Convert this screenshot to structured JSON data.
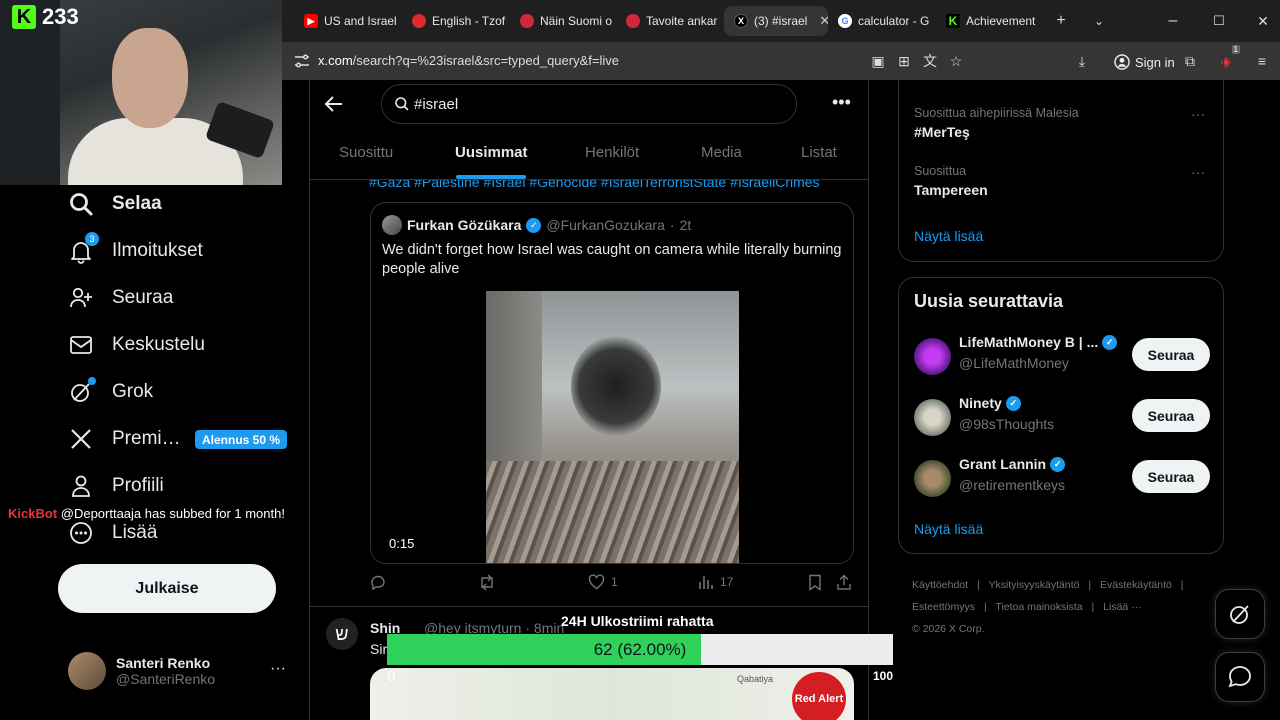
{
  "stream": {
    "viewer_count": "233",
    "kickbot_name": "KickBot",
    "kickbot_message": "@Deporttaaja has subbed for 1 month!",
    "goal": {
      "title": "24H Ulkostriimi rahatta",
      "label": "62 (62.00%)",
      "value": 62,
      "max": 100,
      "percent": 62,
      "min_label": "0",
      "max_label": "100"
    }
  },
  "browser": {
    "tabs": [
      {
        "label": "US and Israel",
        "icon": "youtube-icon",
        "color": "#ff0000",
        "active": false
      },
      {
        "label": "English - Tzof",
        "icon": "red-fav-icon",
        "color": "#e0282e",
        "active": false
      },
      {
        "label": "Näin Suomi o",
        "icon": "yle-icon",
        "color": "#d2283c",
        "active": false
      },
      {
        "label": "Tavoite ankar",
        "icon": "yle-icon",
        "color": "#d2283c",
        "active": false
      },
      {
        "label": "(3) #israel",
        "icon": "x-icon",
        "color": "#000000",
        "active": true
      },
      {
        "label": "calculator - G",
        "icon": "google-icon",
        "color": "#4285f4",
        "active": false
      },
      {
        "label": "Achievement",
        "icon": "kick-icon",
        "color": "#53fc18",
        "active": false
      }
    ],
    "url_host": "x.com",
    "url_path": "/search?q=%23israel&src=typed_query&f=live",
    "sign_in_label": "Sign in",
    "extension_badge": "1"
  },
  "nav": {
    "items": [
      {
        "key": "explore",
        "label": "Selaa",
        "icon": "search-icon",
        "bold": true
      },
      {
        "key": "notifications",
        "label": "Ilmoitukset",
        "icon": "bell-icon",
        "badge": "3"
      },
      {
        "key": "follow",
        "label": "Seuraa",
        "icon": "person-add-icon"
      },
      {
        "key": "messages",
        "label": "Keskustelu",
        "icon": "mail-icon"
      },
      {
        "key": "grok",
        "label": "Grok",
        "icon": "grok-icon"
      },
      {
        "key": "premium",
        "label": "Premi…",
        "icon": "x-logo-icon"
      },
      {
        "key": "profile",
        "label": "Profiili",
        "icon": "person-icon"
      },
      {
        "key": "more",
        "label": "Lisää",
        "icon": "more-circle-icon"
      }
    ],
    "premium_badge": "Alennus 50 %",
    "post_button": "Julkaise",
    "profile_name": "Santeri Renko",
    "profile_handle": "@SanteriRenko"
  },
  "search": {
    "query": "#israel",
    "tabs": [
      {
        "label": "Suosittu",
        "active": false
      },
      {
        "label": "Uusimmat",
        "active": true
      },
      {
        "label": "Henkilöt",
        "active": false
      },
      {
        "label": "Media",
        "active": false
      },
      {
        "label": "Listat",
        "active": false
      }
    ]
  },
  "post": {
    "hashtags": "#Gaza #Palestine #Israel #Genocide #IsraelTerroristState #IsraeliCrimes",
    "quote": {
      "author_name": "Furkan Gözükara",
      "author_handle": "@FurkanGozukara",
      "time": "2t",
      "text": "We didn't forget how Israel was caught on camera while literally burning people alive",
      "video_duration": "0:15"
    },
    "actions": {
      "likes": "1",
      "views": "17"
    }
  },
  "next_post": {
    "name": "Shin",
    "meta": "@hey itsmyturn · 8min",
    "text_snippet": "Sir",
    "map_place": "Qabatiya",
    "map_badge": "Red Alert"
  },
  "right": {
    "trends": [
      {
        "context": "Suosittua aihepiirissä Malesia",
        "title": "#MerTeş"
      },
      {
        "context": "Suosittua",
        "title": "Tampereen"
      }
    ],
    "show_more": "Näytä lisää",
    "who_to_follow": {
      "title": "Uusia seurattavia",
      "accounts": [
        {
          "name": "LifeMathMoney B | ...",
          "handle": "@LifeMathMoney",
          "button": "Seuraa"
        },
        {
          "name": "Ninety",
          "handle": "@98sThoughts",
          "button": "Seuraa"
        },
        {
          "name": "Grant Lannin",
          "handle": "@retirementkeys",
          "button": "Seuraa"
        }
      ],
      "show_more": "Näytä lisää"
    },
    "footer": [
      "Käyttöehdot",
      "|",
      "Yksityisyyskäytäntö",
      "|",
      "Evästekäytäntö",
      "|",
      "Esteettömyys",
      "|",
      "Tietoa mainoksista",
      "|",
      "Lisää ···",
      "© 2026 X Corp."
    ]
  },
  "colors": {
    "accent": "#1d9bf0",
    "goal_fill": "#2ed15a",
    "kick_green": "#53fc18",
    "kickbot": "#e5363a"
  }
}
